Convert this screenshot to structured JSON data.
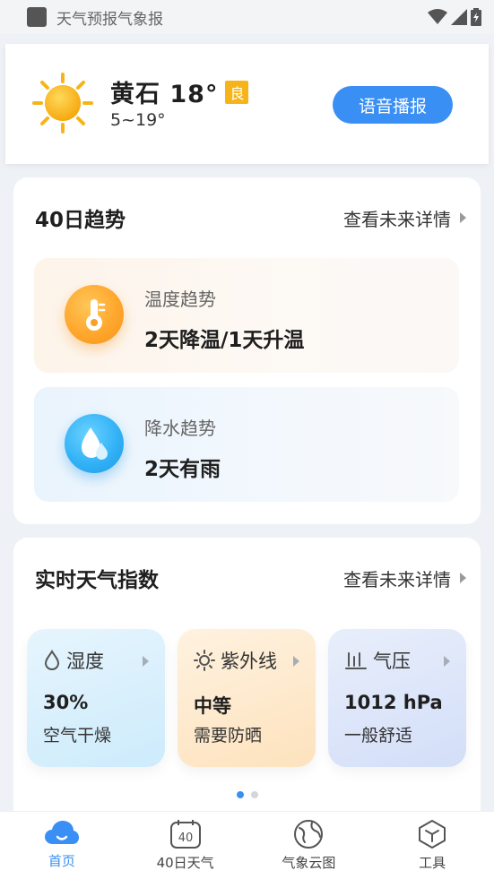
{
  "status_bar": {
    "app_title": "天气预报气象报"
  },
  "location": {
    "city_temp": "黄石 18°",
    "aqi": "良",
    "temp_range": "5~19°",
    "voice_button": "语音播报"
  },
  "trend_section": {
    "title": "40日趋势",
    "link": "查看未来详情",
    "items": [
      {
        "label": "温度趋势",
        "value": "2天降温/1天升温"
      },
      {
        "label": "降水趋势",
        "value": "2天有雨"
      }
    ]
  },
  "index_section": {
    "title": "实时天气指数",
    "link": "查看未来详情",
    "cards": [
      {
        "label": "湿度",
        "value": "30%",
        "desc": "空气干燥"
      },
      {
        "label": "紫外线",
        "value": "中等",
        "desc": "需要防晒"
      },
      {
        "label": "气压",
        "value": "1012 hPa",
        "desc": "一般舒适"
      }
    ],
    "page_count": 2,
    "active_page": 0
  },
  "bottom_nav": {
    "items": [
      {
        "label": "首页",
        "icon": "cloud-icon",
        "active": true
      },
      {
        "label": "40日天气",
        "icon": "calendar-40-icon",
        "calendar_number": "40",
        "active": false
      },
      {
        "label": "气象云图",
        "icon": "globe-icon",
        "active": false
      },
      {
        "label": "工具",
        "icon": "toolbox-icon",
        "active": false
      }
    ]
  },
  "colors": {
    "accent": "#3a8ff4",
    "aqi_badge": "#f6b418",
    "sun": "#f7b417"
  }
}
